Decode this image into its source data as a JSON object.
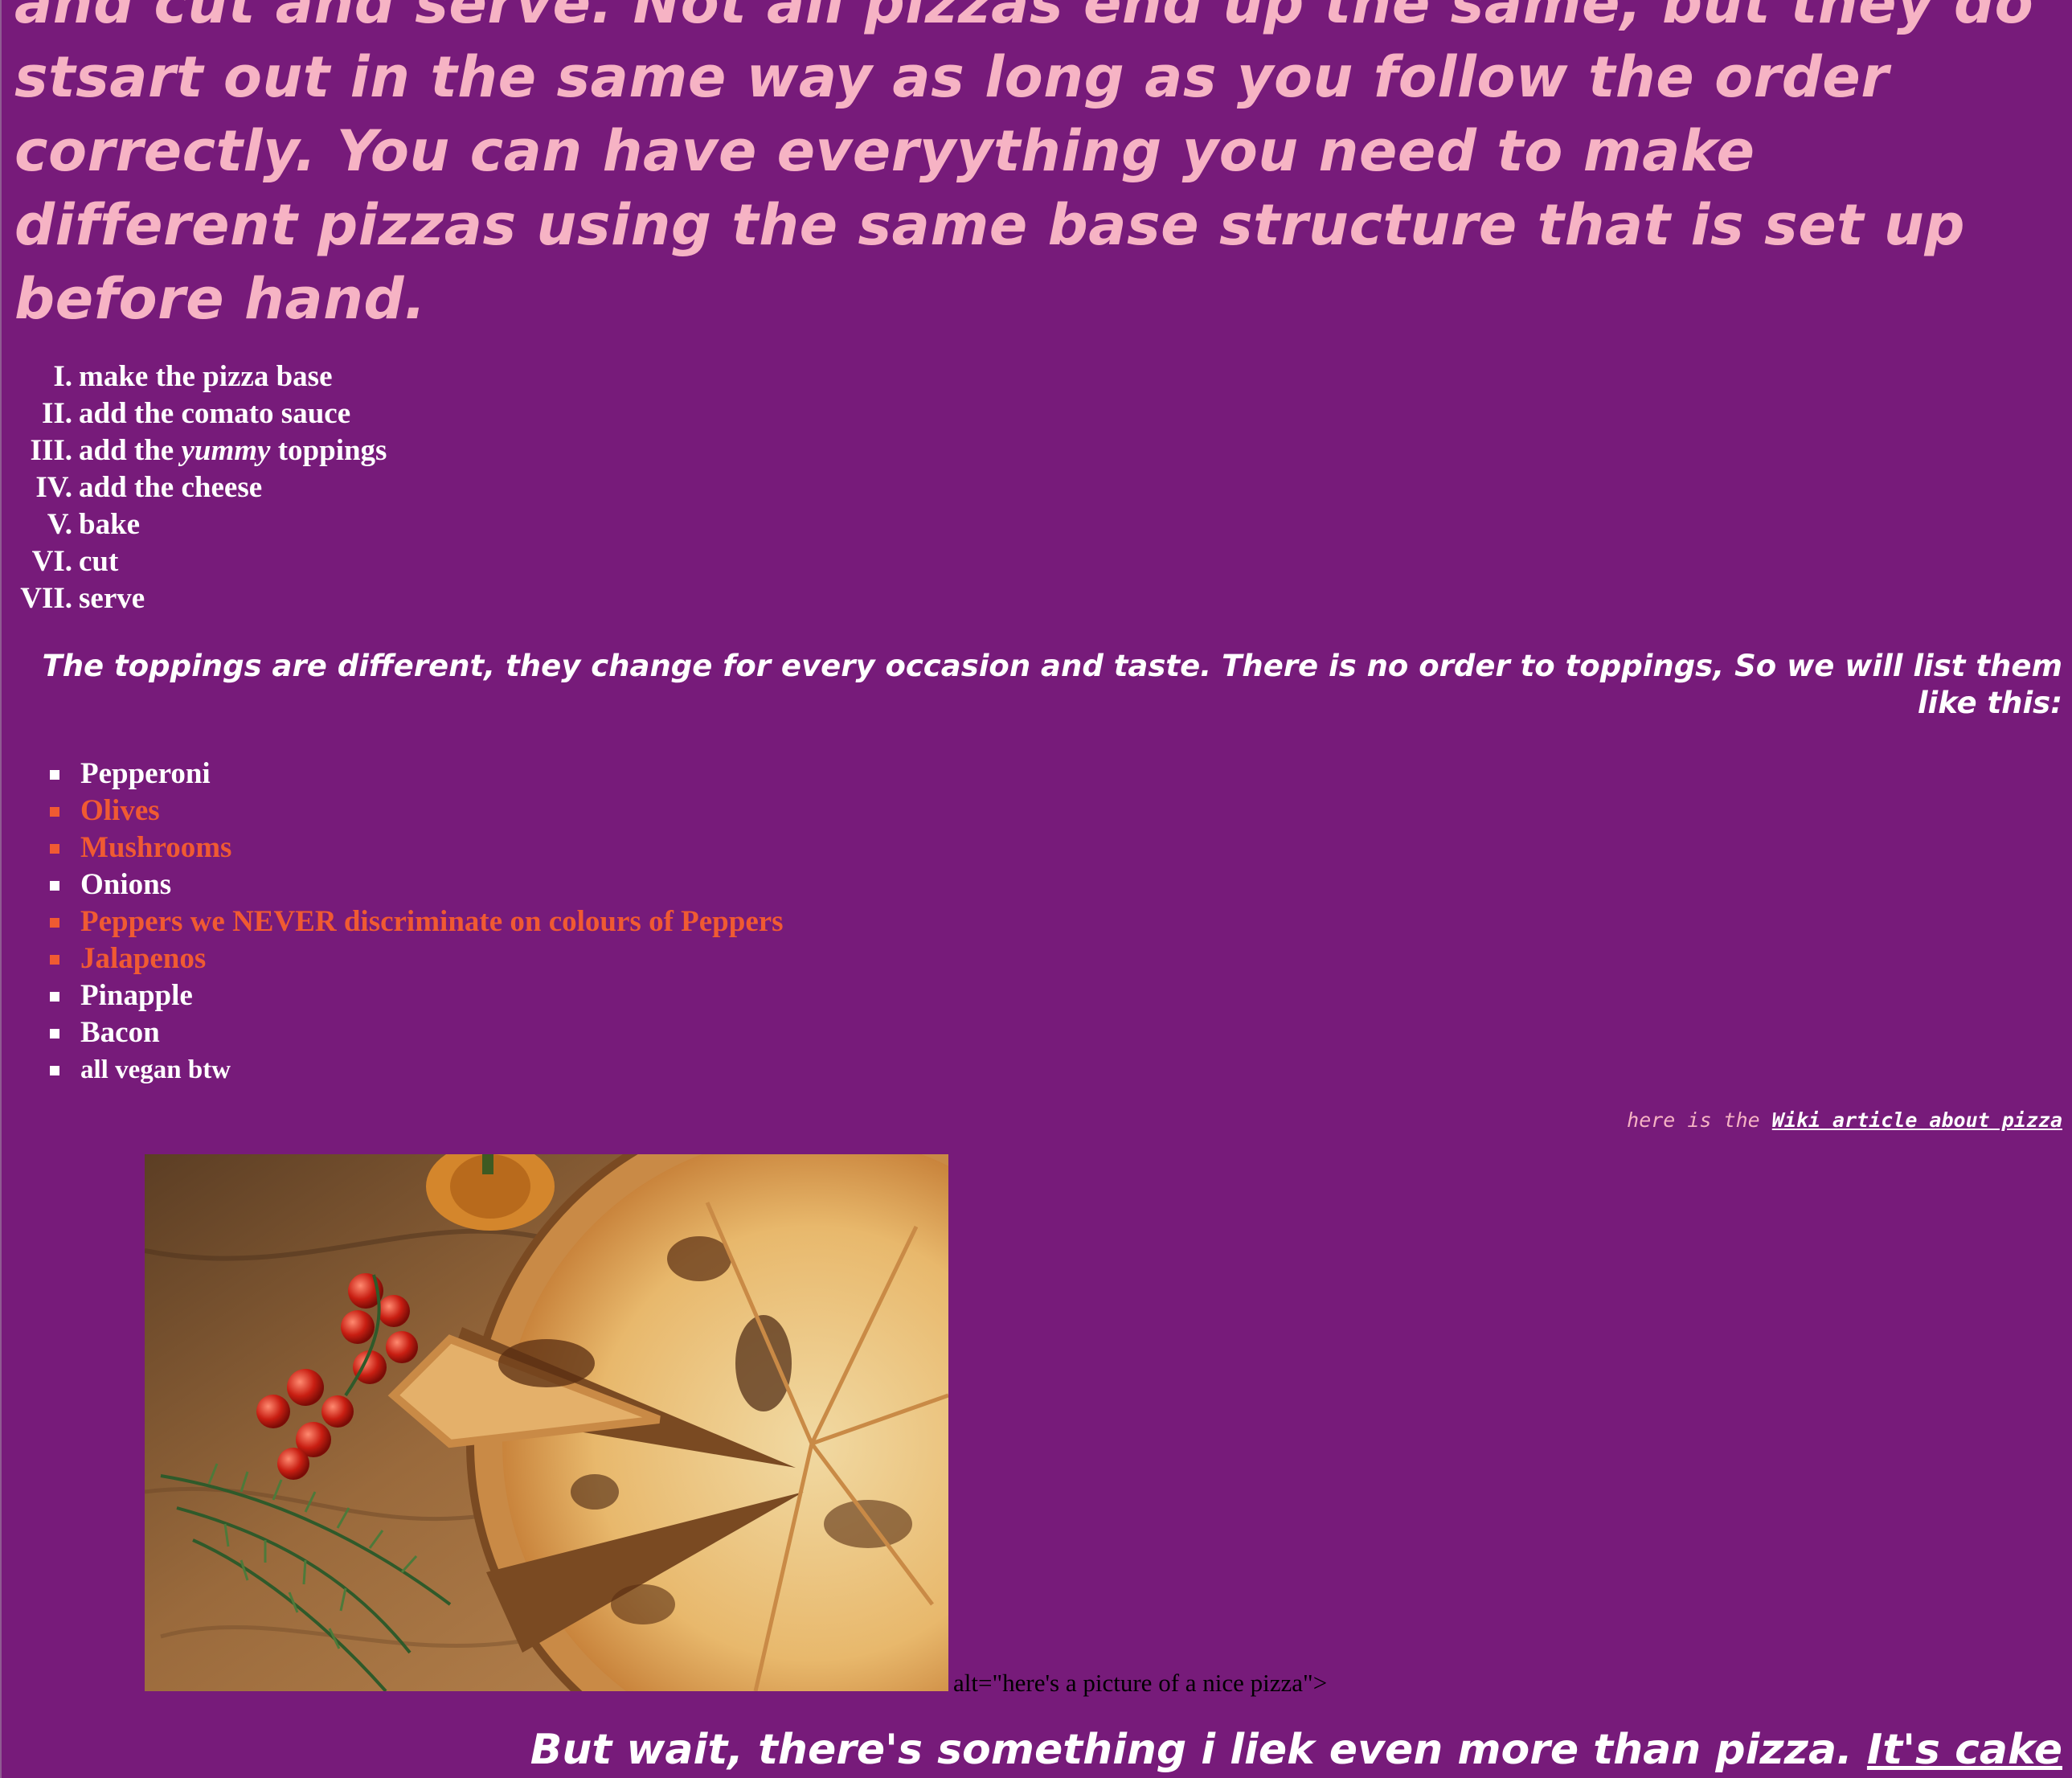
{
  "intro": {
    "text": "and cut and serve. Not all pizzas end up the same, but they do stsart out in the same way as long as you follow the order correctly. You can have everyything you need to make different pizzas using the same base structure that is set up before hand."
  },
  "steps": [
    {
      "num": "I.",
      "text": "make the pizza base"
    },
    {
      "num": "II.",
      "text": "add the comato sauce"
    },
    {
      "num": "III.",
      "before": "add the ",
      "em": "yummy",
      "after": " toppings"
    },
    {
      "num": "IV.",
      "text": "add the cheese"
    },
    {
      "num": "V.",
      "text": "bake"
    },
    {
      "num": "VI.",
      "text": "cut"
    },
    {
      "num": "VII.",
      "text": "serve"
    }
  ],
  "toppings_intro": "The toppings are different, they change for every occasion and taste. There is no order to toppings, So we will list them like this:",
  "toppings": [
    {
      "label": "Pepperoni",
      "color": "#ffffff"
    },
    {
      "label": "Olives",
      "color": "#f05a32"
    },
    {
      "label": "Mushrooms",
      "color": "#f05a32"
    },
    {
      "label": "Onions",
      "color": "#ffffff"
    },
    {
      "label": "Peppers we NEVER discriminate on colours of Peppers",
      "color": "#f05a32"
    },
    {
      "label": "Jalapenos",
      "color": "#f05a32"
    },
    {
      "label": "Pinapple",
      "color": "#ffffff"
    },
    {
      "label": "Bacon",
      "color": "#ffffff"
    },
    {
      "label": "all vegan btw",
      "color": "#ffffff"
    }
  ],
  "wiki": {
    "prefix": "here is the ",
    "link_label": "Wiki article about pizza"
  },
  "image": {
    "alt_text_residue": "alt=\"here's a picture of a nice pizza\">"
  },
  "closing": {
    "text": "But wait, there's something i liek even more than pizza. ",
    "link_label": "It's cake"
  },
  "colors": {
    "background": "#771b7a",
    "intro_text": "#f6b3c4",
    "accent_orange": "#f05a32",
    "white": "#ffffff"
  }
}
